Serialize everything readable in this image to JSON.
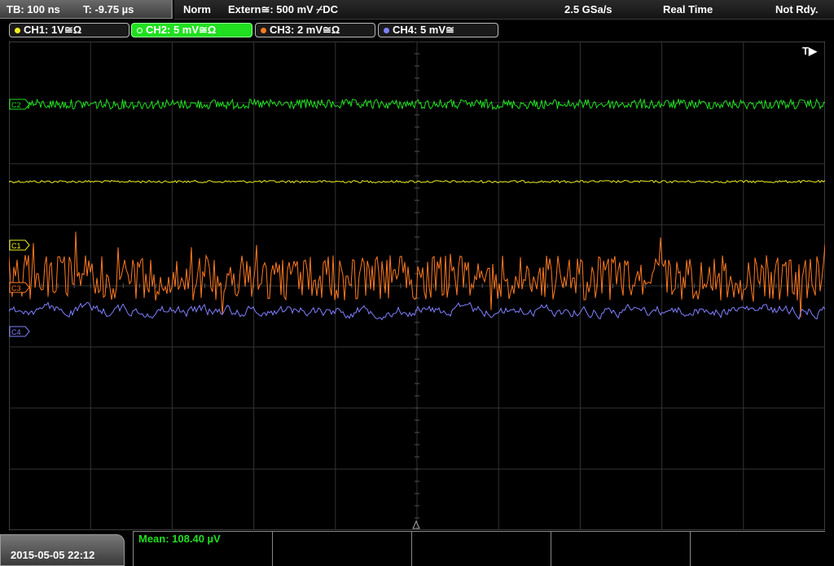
{
  "topbar": {
    "timebase": "TB: 100 ns",
    "trigger_time": "T: -9.75 µs",
    "mode": "Norm",
    "trigger_source": "Extern≅: 500 mV ⌿DC",
    "sample_rate": "2.5 GSa/s",
    "acq_mode": "Real Time",
    "status": "Not Rdy."
  },
  "channels": [
    {
      "id": "ch1",
      "label": "CH1: 1V≅Ω",
      "color": "#f0f020",
      "marker": "C1"
    },
    {
      "id": "ch2",
      "label": "CH2: 5 mV≅Ω",
      "color": "#20e020",
      "marker": "C2"
    },
    {
      "id": "ch3",
      "label": "CH3: 2 mV≅Ω",
      "color": "#ff7a20",
      "marker": "C3"
    },
    {
      "id": "ch4",
      "label": "CH4: 5 mV≅",
      "color": "#8080ff",
      "marker": "C4"
    }
  ],
  "trigger_marker": "T▶",
  "date_time": "2015-05-05 22:12",
  "measurement": {
    "mean_label": "Mean: 108.40 µV"
  }
}
